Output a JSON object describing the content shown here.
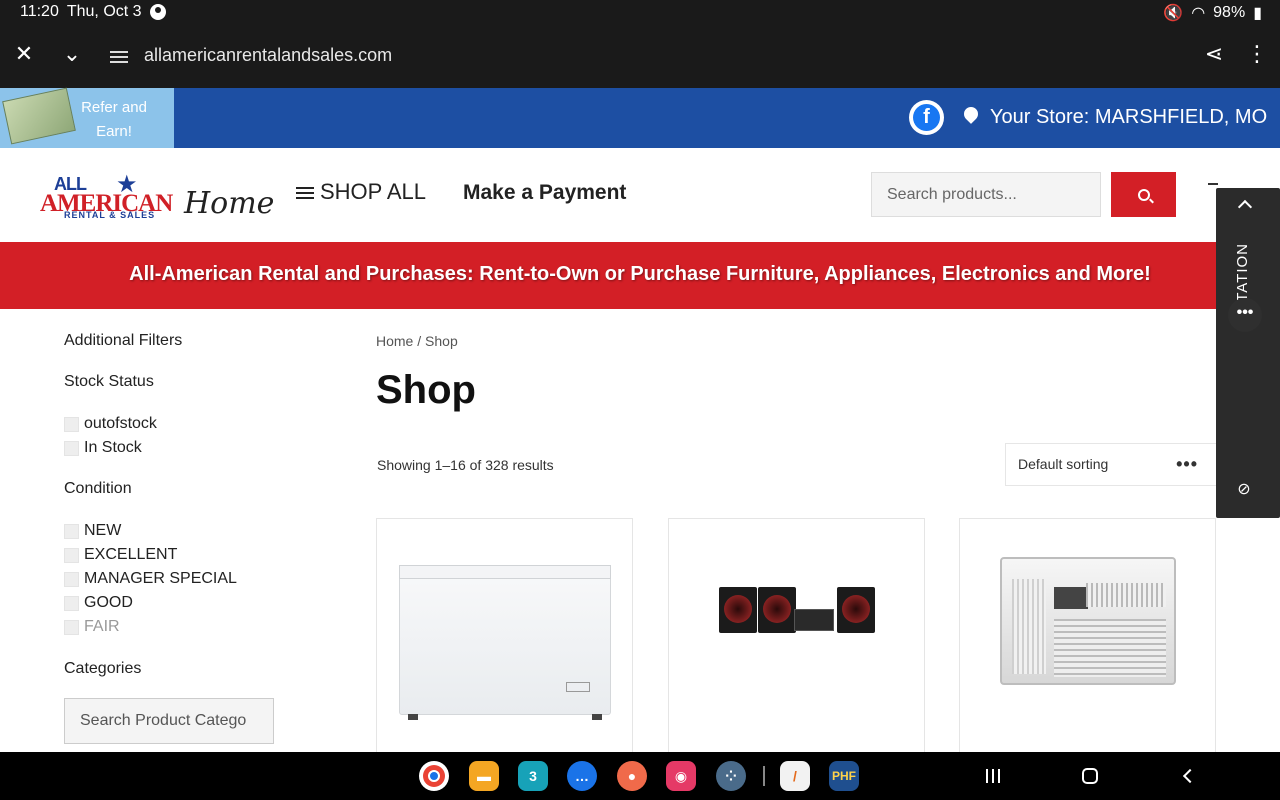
{
  "status": {
    "time": "11:20",
    "date": "Thu, Oct 3",
    "battery": "98%"
  },
  "browser": {
    "url": "allamericanrentalandsales.com"
  },
  "topstrip": {
    "refer_label": "Refer and Earn!",
    "store_label": "Your Store: MARSHFIELD, MO"
  },
  "header": {
    "logo": {
      "line1": "ALL",
      "line2": "AMERICAN",
      "line3": "RENTAL & SALES",
      "script": "Home"
    },
    "shop_all": "SHOP ALL",
    "make_payment": "Make a Payment",
    "search_placeholder": "Search products..."
  },
  "banner": {
    "text": "All-American Rental and Purchases: Rent-to-Own or Purchase Furniture, Appliances, Electronics and More!"
  },
  "sidebar": {
    "title": "Additional Filters",
    "stock_status": {
      "label": "Stock Status",
      "options": [
        "outofstock",
        "In Stock"
      ]
    },
    "condition": {
      "label": "Condition",
      "options": [
        "NEW",
        "EXCELLENT",
        "MANAGER SPECIAL",
        "GOOD",
        "FAIR"
      ]
    },
    "categories": {
      "label": "Categories",
      "search_placeholder": "Search Product Catego"
    }
  },
  "main": {
    "breadcrumb": {
      "home": "Home",
      "sep": " / ",
      "current": "Shop"
    },
    "title": "Shop",
    "results": "Showing 1–16 of 328 results",
    "sorting": "Default sorting"
  },
  "products": [
    {
      "name": "chest-freezer"
    },
    {
      "name": "speaker-system"
    },
    {
      "name": "window-air-conditioner"
    }
  ],
  "sidepanel": {
    "label": "LTATION"
  },
  "navbar": {
    "apps": [
      {
        "name": "chrome",
        "color": "#ffffff"
      },
      {
        "name": "files",
        "color": "#f4a623"
      },
      {
        "name": "calendar",
        "color": "#17a2b8"
      },
      {
        "name": "messages",
        "color": "#1a73e8"
      },
      {
        "name": "contacts",
        "color": "#f06a4a"
      },
      {
        "name": "camera",
        "color": "#e53966"
      },
      {
        "name": "apps",
        "color": "#4a6b8a"
      },
      {
        "name": "notes",
        "color": "#f2f2f2"
      },
      {
        "name": "phf",
        "color": "#1f4f8f",
        "label": "PHF"
      }
    ]
  },
  "colors": {
    "brand_red": "#d31f26",
    "brand_blue": "#1d4fa3",
    "refer_bg": "#8cc3ea"
  }
}
